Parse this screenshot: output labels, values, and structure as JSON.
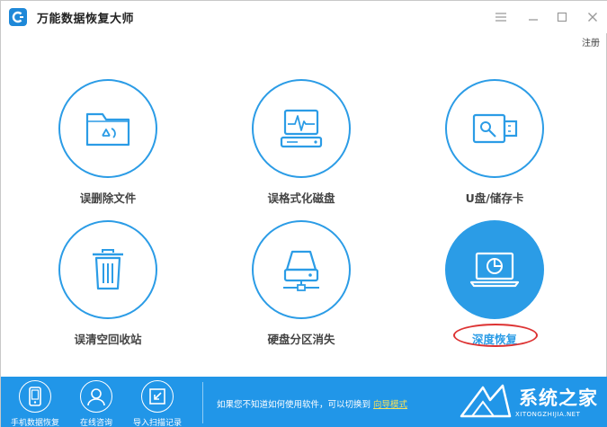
{
  "app": {
    "title": "万能数据恢复大师"
  },
  "window": {
    "register_label": "注册"
  },
  "tiles": [
    {
      "label": "误删除文件",
      "icon": "deleted-folder-icon"
    },
    {
      "label": "误格式化磁盘",
      "icon": "formatted-disk-icon"
    },
    {
      "label": "U盘/储存卡",
      "icon": "usb-drive-icon"
    },
    {
      "label": "误清空回收站",
      "icon": "recycle-bin-icon"
    },
    {
      "label": "硬盘分区消失",
      "icon": "hard-drive-partition-icon"
    },
    {
      "label": "深度恢复",
      "icon": "deep-recovery-laptop-icon",
      "active": true
    }
  ],
  "bottom": {
    "items": [
      {
        "label": "手机数据恢复",
        "icon": "phone-icon"
      },
      {
        "label": "在线咨询",
        "icon": "user-support-icon"
      },
      {
        "label": "导入扫描记录",
        "icon": "import-icon"
      }
    ],
    "hint_text": "如果您不知道如何使用软件，可以切换到",
    "hint_link": "向导模式"
  },
  "watermark": {
    "brand": "系统之家",
    "url": "XITONGZHIJIA.NET"
  },
  "colors": {
    "accent": "#2b9ce6",
    "bottom_bar": "#2196e8",
    "highlight_oval": "#dd3333"
  }
}
